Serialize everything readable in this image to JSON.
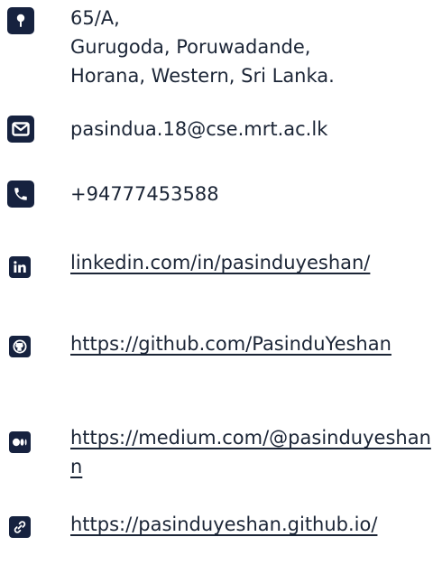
{
  "contact": {
    "address": {
      "icon": "location-pin-icon",
      "lines": [
        "65/A,",
        "Gurugoda, Poruwadande,",
        "Horana, Western, Sri Lanka."
      ]
    },
    "email": {
      "icon": "envelope-icon",
      "text": "pasindua.18@cse.mrt.ac.lk"
    },
    "phone": {
      "icon": "phone-icon",
      "text": "+94777453588"
    },
    "linkedin": {
      "icon": "linkedin-icon",
      "text": "linkedin.com/in/pasinduyeshan/"
    },
    "github": {
      "icon": "github-icon",
      "text": "https://github.com/PasinduYeshan"
    },
    "medium": {
      "icon": "medium-icon",
      "text": "https://medium.com/@pasinduyeshann"
    },
    "website": {
      "icon": "link-icon",
      "text": "https://pasinduyeshan.github.io/"
    }
  },
  "colors": {
    "icon_bg": "#16223f",
    "text": "#1b2536"
  }
}
